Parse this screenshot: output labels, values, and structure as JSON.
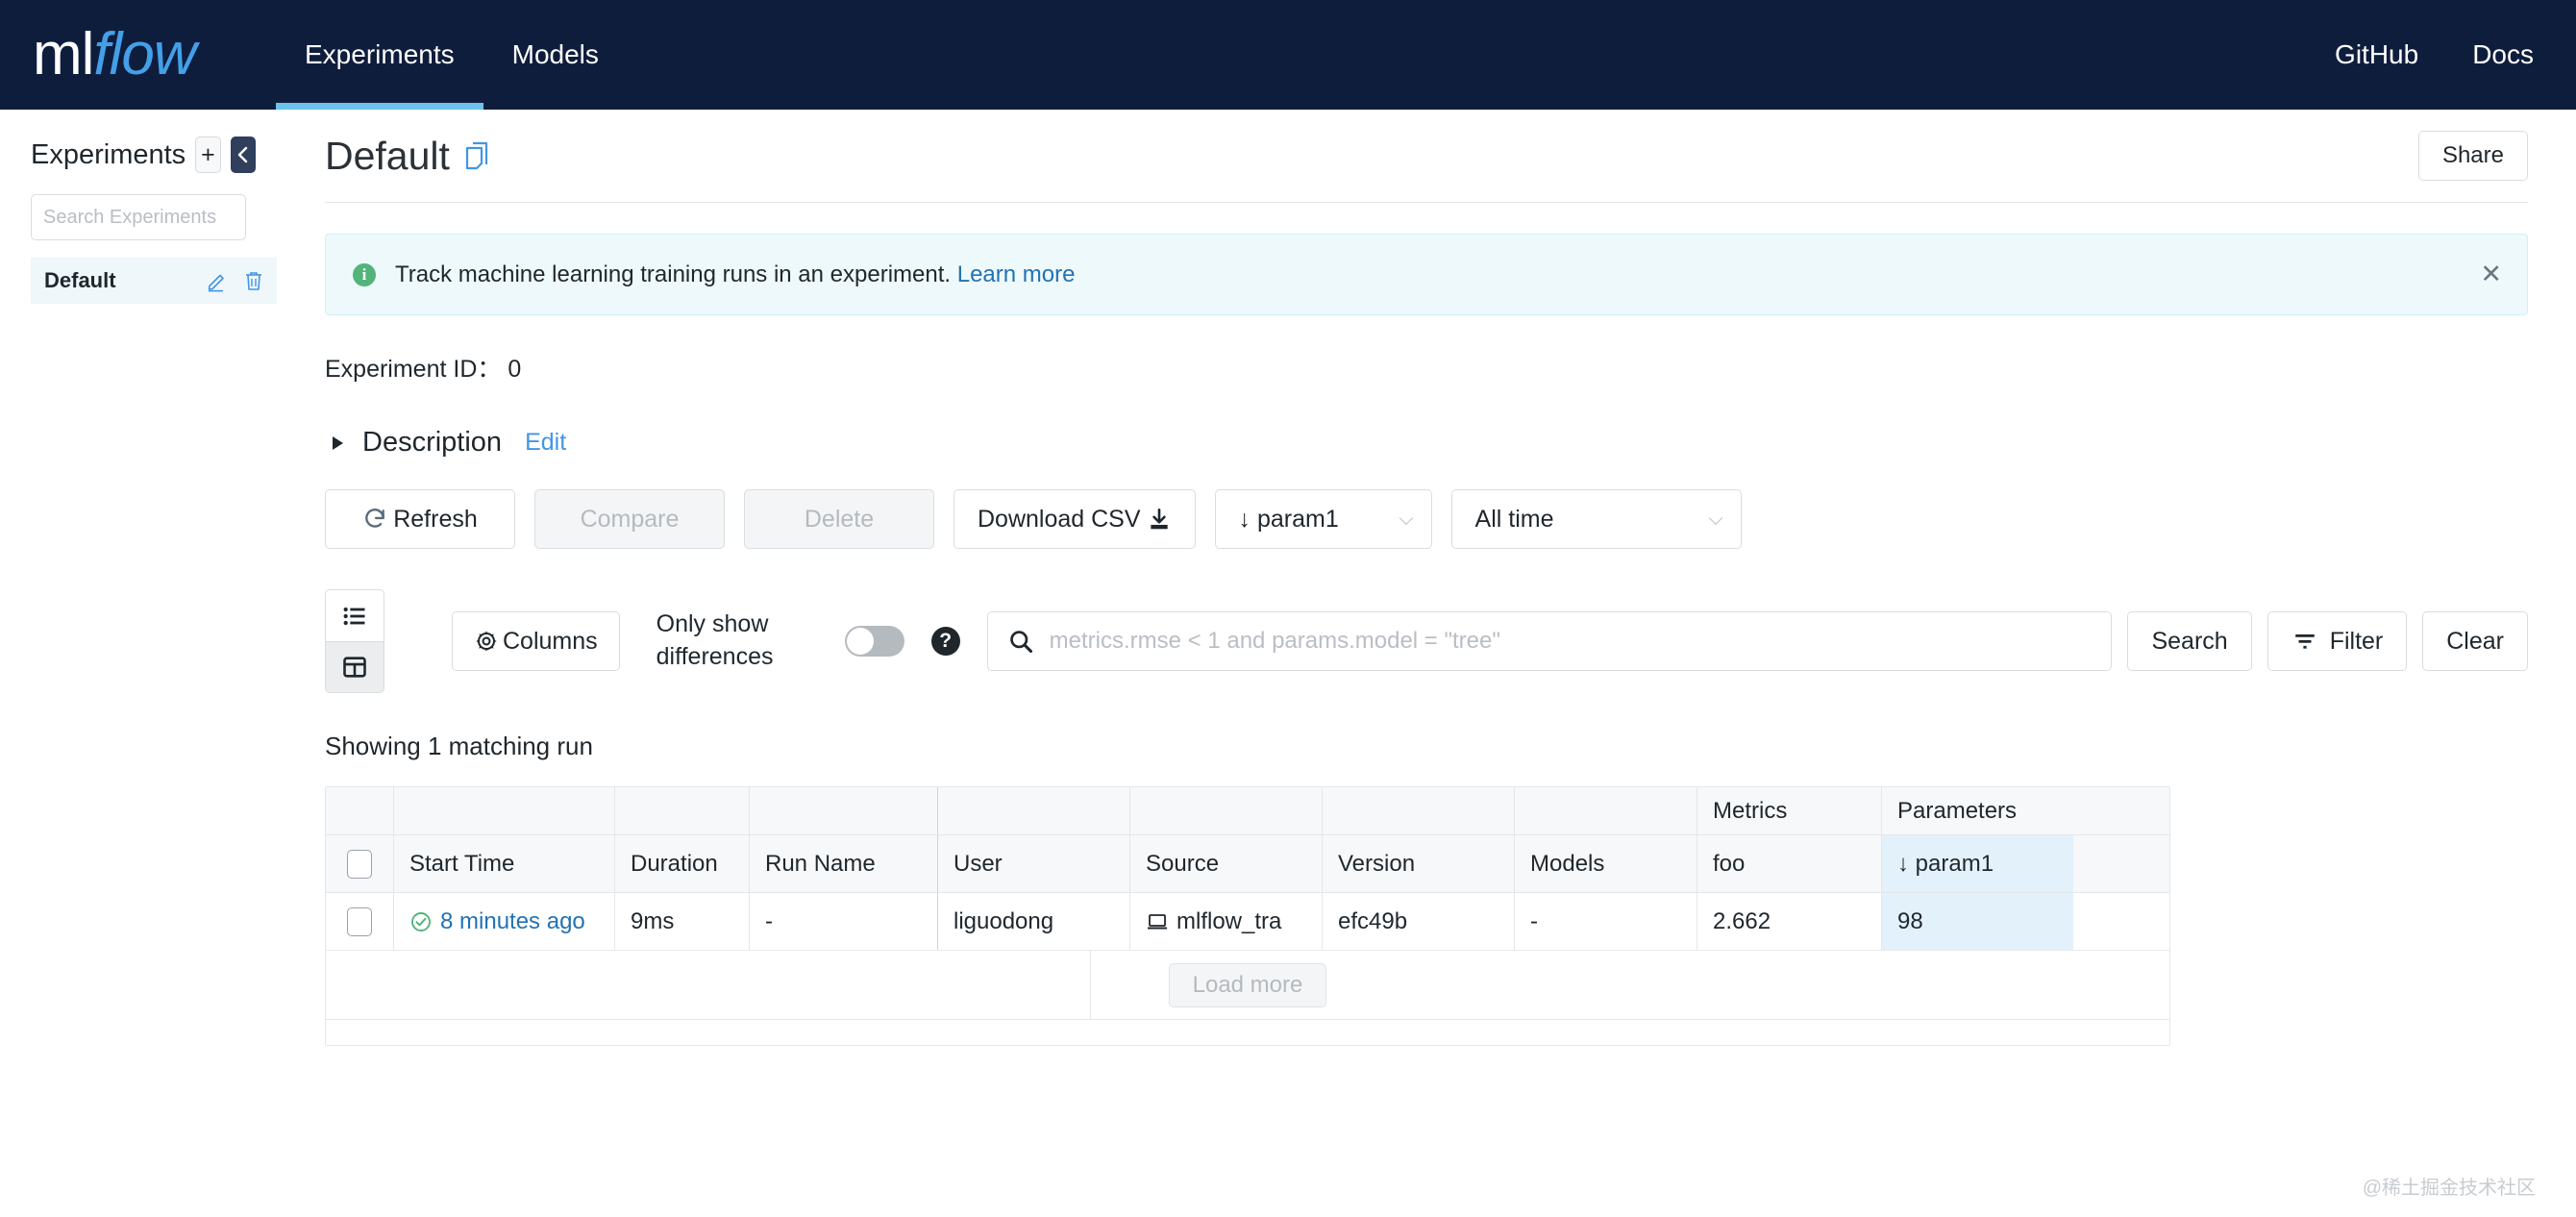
{
  "topnav": {
    "logo_ml": "ml",
    "logo_flow": "flow",
    "tabs": [
      {
        "label": "Experiments",
        "active": true
      },
      {
        "label": "Models",
        "active": false
      }
    ],
    "links": [
      {
        "label": "GitHub"
      },
      {
        "label": "Docs"
      }
    ]
  },
  "sidebar": {
    "title": "Experiments",
    "new_button": "+",
    "collapse_button": "‹",
    "search_placeholder": "Search Experiments",
    "search_value": "",
    "items": [
      {
        "label": "Default",
        "selected": true,
        "edit_icon": "pencil-icon",
        "delete_icon": "trash-icon"
      }
    ]
  },
  "header": {
    "title": "Default",
    "copy_icon": "copy-icon",
    "share_label": "Share"
  },
  "banner": {
    "icon": "info-icon",
    "icon_glyph": "i",
    "text": "Track machine learning training runs in an experiment.",
    "link_label": "Learn more",
    "close_glyph": "✕"
  },
  "experiment": {
    "id_label": "Experiment ID：",
    "id_value": "0",
    "description_label": "Description",
    "description_edit": "Edit"
  },
  "toolbar": {
    "refresh_label": "Refresh",
    "refresh_icon": "refresh-icon",
    "compare_label": "Compare",
    "delete_label": "Delete",
    "download_label": "Download CSV",
    "download_icon": "download-icon",
    "sort_label": "↓ param1",
    "sort_chevron": "⌵",
    "time_label": "All time",
    "time_chevron": "⌵",
    "list_view_icon": "list-view-icon",
    "grid_view_icon": "grid-view-icon",
    "columns_label": "Columns",
    "columns_icon": "gear-icon",
    "only_show_differences_label": "Only show differences",
    "only_show_differences_on": false,
    "help_glyph": "?",
    "search_placeholder": "metrics.rmse < 1 and params.model = \"tree\"",
    "search_value": "",
    "search_icon": "search-icon",
    "search_button": "Search",
    "filter_button": "Filter",
    "filter_icon": "filter-icon",
    "clear_button": "Clear"
  },
  "results": {
    "showing_text": "Showing 1 matching run",
    "group_headers": [
      "",
      "",
      "",
      "",
      "",
      "",
      "",
      "Metrics",
      "Parameters"
    ],
    "columns": [
      "Start Time",
      "Duration",
      "Run Name",
      "User",
      "Source",
      "Version",
      "Models",
      "foo",
      "↓ param1"
    ],
    "rows": [
      {
        "selected": false,
        "status_icon": "success-check-icon",
        "start_time": "8 minutes ago",
        "duration": "9ms",
        "run_name": "-",
        "user": "liguodong",
        "source_icon": "laptop-icon",
        "source": "mlflow_tra",
        "version": "efc49b",
        "models": "-",
        "foo": "2.662",
        "param1": "98"
      }
    ],
    "load_more_label": "Load more"
  },
  "watermark": "@稀土掘金技术社区",
  "colors": {
    "nav_bg": "#0f1d3d",
    "nav_active_underline": "#6bc2eb",
    "link_blue": "#2272b4",
    "accent_blue": "#4295e6",
    "banner_bg": "#eef9fb",
    "success_green": "#52b47a",
    "highlight_col": "#e3f1fb",
    "sidebar_selected": "#eff7fb"
  }
}
